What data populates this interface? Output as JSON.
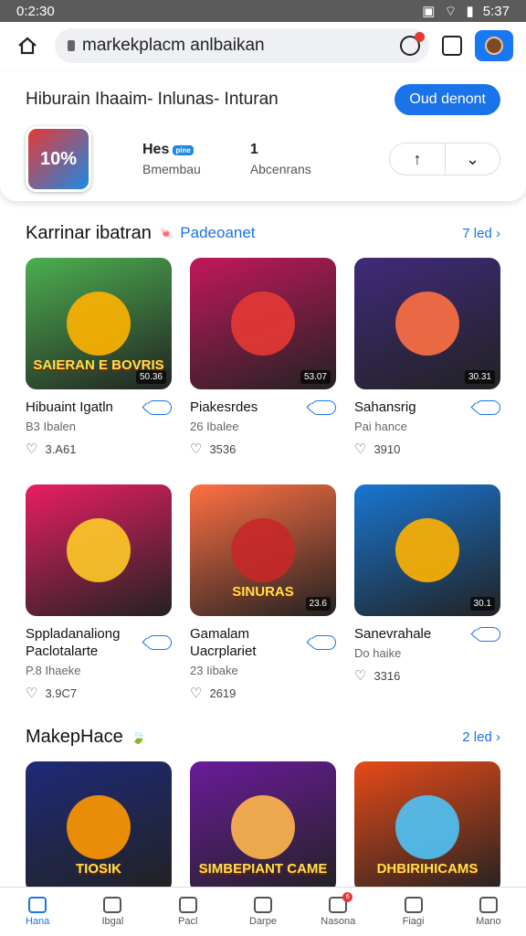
{
  "status_bar": {
    "time": "0:2:30",
    "battery": "5:37"
  },
  "browser": {
    "url": "markekplacm anlbaikan"
  },
  "app_card": {
    "title": "Hiburain Ihaaim- Inlunas- Inturan",
    "install_label": "Oud denont",
    "icon_text": "10%",
    "stat1_top": "Hes",
    "stat1_badge": "pine",
    "stat1_bottom": "Bmembau",
    "stat2_top": "1",
    "stat2_bottom": "Abcenrans",
    "upvote_icon": "arrow-up-icon",
    "downvote_icon": "chevron-down-icon"
  },
  "section1": {
    "title": "Karrinar ibatran",
    "subtitle": "Padeoanet",
    "more": "7 led",
    "tiles": [
      {
        "name": "Hibuaint Igatln",
        "sub": "B3 Ibalen",
        "likes": "3.A61",
        "badge": "50.36",
        "art_text": "SAIERAN\nE BOVRIS",
        "bg": "#4caf50",
        "art": "#ffb300"
      },
      {
        "name": "Piakesrdes",
        "sub": "26 Ibalee",
        "likes": "3536",
        "badge": "53.07",
        "art_text": "",
        "bg": "#c2185b",
        "art": "#e53935"
      },
      {
        "name": "Sahansrig",
        "sub": "Pai hance",
        "likes": "3910",
        "badge": "30.31",
        "art_text": "",
        "bg": "#3f2a7a",
        "art": "#ff7043"
      },
      {
        "name": "Sppladanaliong Paclotalarte",
        "sub": "P.8 Ihaeke",
        "likes": "3.9C7",
        "badge": "",
        "art_text": "",
        "bg": "#e91e63",
        "art": "#ffca28"
      },
      {
        "name": "Gamalam Uacrplariet",
        "sub": "23 Iibake",
        "likes": "2619",
        "badge": "23.6",
        "art_text": "SINURAS",
        "bg": "#ff7043",
        "art": "#c62828"
      },
      {
        "name": "Sanevrahale",
        "sub": "Do haike",
        "likes": "3316",
        "badge": "30.1",
        "art_text": "",
        "bg": "#1976d2",
        "art": "#ffb300"
      }
    ]
  },
  "section2": {
    "title": "MakepHace",
    "more": "2 led",
    "tiles": [
      {
        "art_text": "TIOSIK",
        "bg": "#1e2a78",
        "art": "#ff9800"
      },
      {
        "art_text": "SIMBEPIANT\nCAME",
        "bg": "#6a1b9a",
        "art": "#ffb74d"
      },
      {
        "art_text": "DHBIRIHICAMS",
        "bg": "#e64a19",
        "art": "#4fc3f7"
      }
    ]
  },
  "bottom_nav": [
    {
      "label": "Hana",
      "icon": "home-icon",
      "active": true
    },
    {
      "label": "Ibgal",
      "icon": "map-icon",
      "active": false
    },
    {
      "label": "Pacl",
      "icon": "dice-icon",
      "active": false
    },
    {
      "label": "Darpe",
      "icon": "card-icon",
      "active": false
    },
    {
      "label": "Nasona",
      "icon": "bell-icon",
      "badge": "6",
      "active": false
    },
    {
      "label": "Fiagi",
      "icon": "gamepad-icon",
      "active": false
    },
    {
      "label": "Mano",
      "icon": "profile-icon",
      "active": false
    }
  ]
}
